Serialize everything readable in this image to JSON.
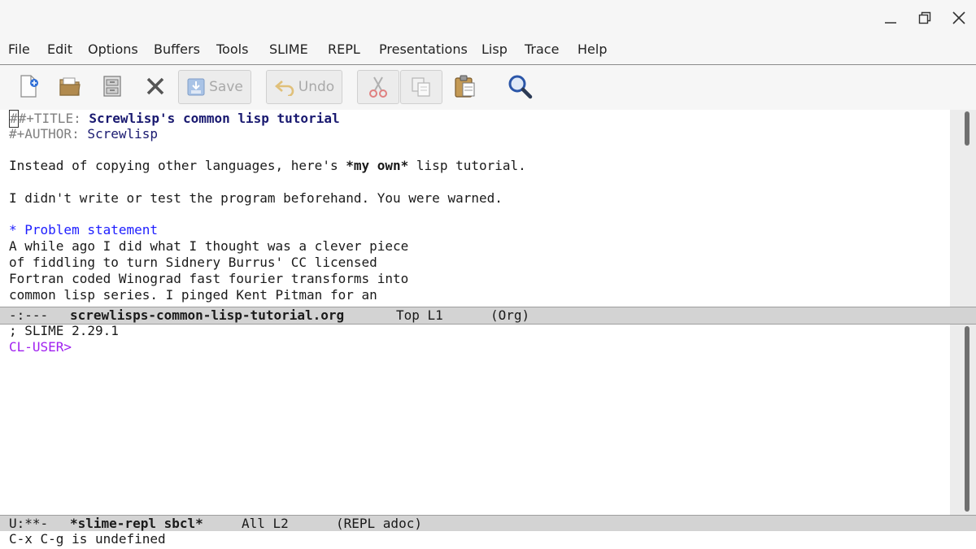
{
  "window_controls": {
    "minimize": "minimize-icon",
    "maximize": "maximize-icon",
    "close": "close-icon"
  },
  "menubar": {
    "items": [
      "File",
      "Edit",
      "Options",
      "Buffers",
      "Tools",
      "SLIME",
      "REPL",
      "Presentations",
      "Lisp",
      "Trace",
      "Help"
    ]
  },
  "toolbar": {
    "save_label": "Save",
    "undo_label": "Undo"
  },
  "org_buffer": {
    "title_keyword": "#+TITLE: ",
    "title_value": "Screwlisp's common lisp tutorial",
    "author_keyword": "#+AUTHOR: ",
    "author_value": "Screwlisp",
    "intro_prefix": "Instead of copying other languages, here's ",
    "intro_bold": "*my own*",
    "intro_suffix": " lisp tutorial.",
    "warning": "I didn't write or test the program beforehand. You were warned.",
    "heading": "* Problem statement",
    "body_lines": [
      "A while ago I did what I thought was a clever piece",
      "of fiddling to turn Sidnery Burrus' CC licensed",
      "Fortran coded Winograd fast fourier transforms into",
      "common lisp series. I pinged Kent Pitman for an"
    ]
  },
  "org_modeline": {
    "state": "-:---",
    "buffer_name": "screwlisps-common-lisp-tutorial.org",
    "position": "Top L1",
    "mode": "(Org)"
  },
  "repl_buffer": {
    "banner": "; SLIME 2.29.1",
    "prompt": "CL-USER>"
  },
  "repl_modeline": {
    "state": "U:**-",
    "buffer_name": "*slime-repl sbcl*",
    "position": "All L2",
    "mode": "(REPL adoc)"
  },
  "minibuffer": {
    "message": "C-x C-g is undefined"
  },
  "colors": {
    "keyword": "#808080",
    "title": "#191970",
    "heading": "#1e1eff",
    "prompt": "#a020f0",
    "modeline_bg": "#d3d3d3"
  }
}
